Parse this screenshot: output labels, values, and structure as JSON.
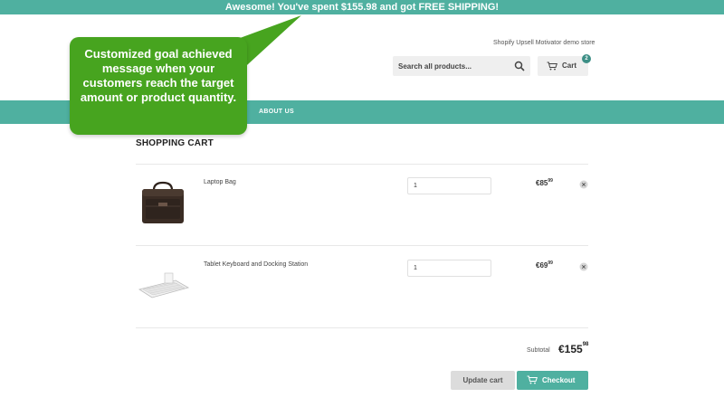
{
  "announcement": {
    "text": "Awesome! You've spent $155.98 and got FREE SHIPPING!"
  },
  "header": {
    "store_name": "Shopify Upsell Motivator demo store",
    "search_placeholder": "Search all products...",
    "search_icon": "search-icon",
    "cart_label": "Cart",
    "cart_icon": "cart-icon",
    "cart_count": "2"
  },
  "nav": {
    "items": [
      {
        "label": "ABOUT US"
      }
    ]
  },
  "callout": {
    "text": "Customized goal achieved message when your customers reach the target amount or product quantity."
  },
  "cart": {
    "heading": "SHOPPING CART",
    "items": [
      {
        "name": "Laptop Bag",
        "quantity": "1",
        "price_main": "€85",
        "price_cents": "99",
        "remove_icon": "close-icon"
      },
      {
        "name": "Tablet Keyboard and Docking Station",
        "quantity": "1",
        "price_main": "€69",
        "price_cents": "99",
        "remove_icon": "close-icon"
      }
    ],
    "subtotal_label": "Subtotal",
    "subtotal_main": "€155",
    "subtotal_cents": "98",
    "update_label": "Update cart",
    "checkout_label": "Checkout"
  },
  "colors": {
    "accent": "#4fb0a0",
    "callout": "#47a41f"
  }
}
